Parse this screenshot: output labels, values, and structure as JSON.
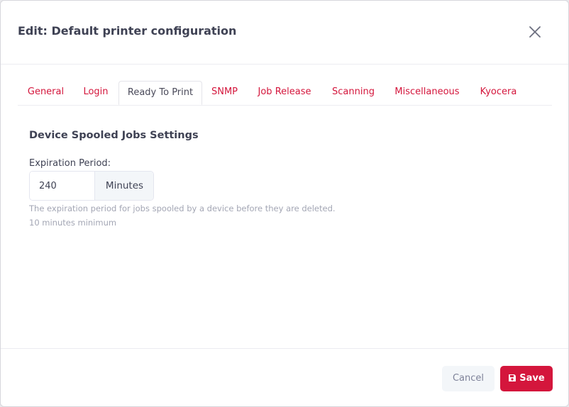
{
  "dialog": {
    "title": "Edit: Default printer configuration"
  },
  "tabs": [
    {
      "label": "General",
      "active": false
    },
    {
      "label": "Login",
      "active": false
    },
    {
      "label": "Ready To Print",
      "active": true
    },
    {
      "label": "SNMP",
      "active": false
    },
    {
      "label": "Job Release",
      "active": false
    },
    {
      "label": "Scanning",
      "active": false
    },
    {
      "label": "Miscellaneous",
      "active": false
    },
    {
      "label": "Kyocera",
      "active": false
    }
  ],
  "section": {
    "title": "Device Spooled Jobs Settings"
  },
  "expiration": {
    "label": "Expiration Period:",
    "value": "240",
    "unit": "Minutes",
    "help_line1": "The expiration period for jobs spooled by a device before they are deleted.",
    "help_line2": "10 minutes minimum"
  },
  "footer": {
    "cancel_label": "Cancel",
    "save_label": "Save"
  },
  "colors": {
    "accent": "#d4163c",
    "text": "#3f4254",
    "muted": "#a3a6b4"
  },
  "icons": {
    "close": "close-icon",
    "save": "save-icon"
  }
}
